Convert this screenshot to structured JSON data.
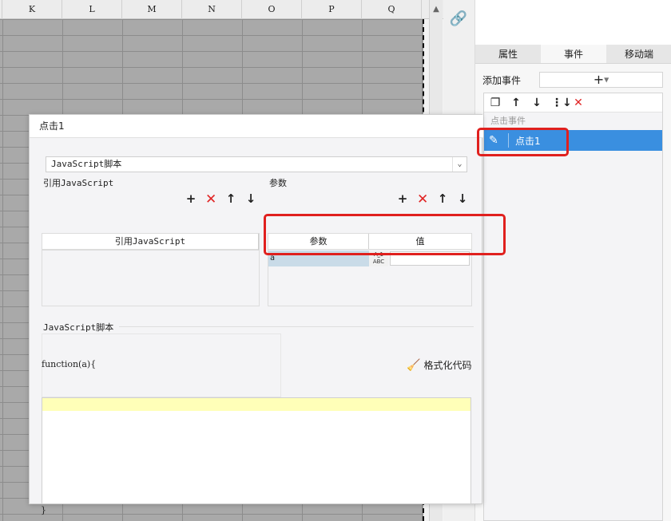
{
  "sheet": {
    "columns": [
      "K",
      "L",
      "M",
      "N",
      "O",
      "P",
      "Q"
    ]
  },
  "right_panel": {
    "tabs": [
      {
        "label": "属性"
      },
      {
        "label": "事件"
      },
      {
        "label": "移动端"
      }
    ],
    "active_tab": "事件",
    "add_event_label": "添加事件",
    "add_event_button": "+",
    "toolbar_icons": [
      "copy-icon",
      "arrow-up-icon",
      "arrow-down-icon",
      "move-to-bottom-icon",
      "delete-icon"
    ],
    "event_category": "点击事件",
    "events": [
      {
        "label": "点击1",
        "selected": true
      }
    ]
  },
  "dialog": {
    "title": "点击1",
    "script_type": "JavaScript脚本",
    "ref_section_label": "引用JavaScript",
    "ref_table_header": "引用JavaScript",
    "param_section_label": "参数",
    "param_table": {
      "headers": [
        "参数",
        "值"
      ],
      "rows": [
        {
          "name": "a",
          "type_badge_top": "A⎵1",
          "type_badge_bottom": "ABC",
          "value": ""
        }
      ]
    },
    "js_section_label": "JavaScript脚本",
    "function_signature": "function(a){",
    "function_close": "}",
    "format_button": "格式化代码"
  },
  "colors": {
    "selection_blue": "#3a8fe0",
    "highlight_red": "#e0201e",
    "delete_red": "#e02424",
    "param_cell": "#c9dbe8",
    "code_line_highlight": "#ffffb8"
  }
}
